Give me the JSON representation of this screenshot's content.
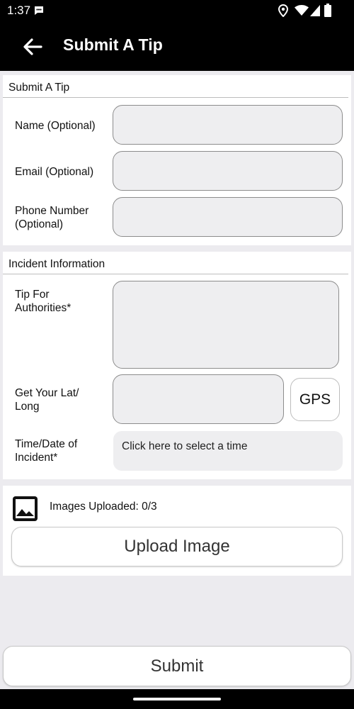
{
  "status_bar": {
    "time": "1:37"
  },
  "app_bar": {
    "title": "Submit A Tip"
  },
  "submit_tip_section": {
    "header": "Submit A Tip",
    "name_label": "Name (Optional)",
    "email_label": "Email (Optional)",
    "phone_label_line1": "Phone Number",
    "phone_label_line2": "(Optional)"
  },
  "incident_section": {
    "header": "Incident Information",
    "tip_label_line1": "Tip For",
    "tip_label_line2": "Authorities*",
    "latlong_label_line1": "Get Your Lat/",
    "latlong_label_line2": "Long",
    "gps_button": "GPS",
    "time_label_line1": "Time/Date of",
    "time_label_line2": "Incident*",
    "time_select_text": "Click here to select a time"
  },
  "images_section": {
    "uploaded_text": "Images Uploaded: 0/3",
    "upload_button": "Upload Image"
  },
  "submit_button": "Submit",
  "colors": {
    "app_bar_bg": "#000000",
    "page_bg": "#ecebef",
    "field_bg": "#eeeef0",
    "card_bg": "#ffffff"
  }
}
